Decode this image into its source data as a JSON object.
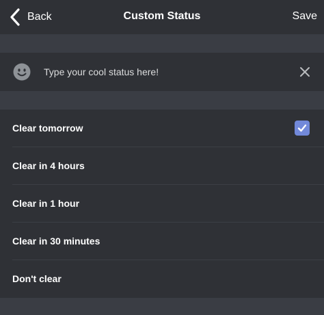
{
  "header": {
    "back_label": "Back",
    "title": "Custom Status",
    "save_label": "Save"
  },
  "status": {
    "placeholder": "Type your cool status here!",
    "emoji_icon": "smiley-face-icon",
    "clear_icon": "close-icon"
  },
  "options": [
    {
      "label": "Clear tomorrow",
      "selected": true
    },
    {
      "label": "Clear in 4 hours",
      "selected": false
    },
    {
      "label": "Clear in 1 hour",
      "selected": false
    },
    {
      "label": "Clear in 30 minutes",
      "selected": false
    },
    {
      "label": "Don't clear",
      "selected": false
    }
  ],
  "colors": {
    "accent": "#7289da",
    "background": "#36393f",
    "panel": "#2f3136"
  }
}
